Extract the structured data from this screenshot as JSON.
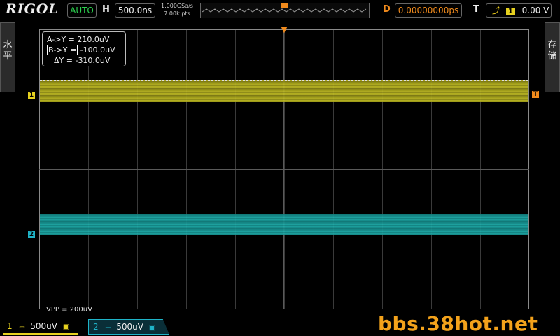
{
  "header": {
    "brand": "RIGOL",
    "run_status": "AUTO",
    "horizontal_label": "H",
    "timebase": "500.0ns",
    "sample_rate": "1.000GSa/s",
    "memory_depth": "7.00k pts",
    "delay_label": "D",
    "delay": "0.00000000ps",
    "trigger_label": "T",
    "trigger_source": "1",
    "trigger_level": "0.00 V"
  },
  "side": {
    "left_tab": "水\n平",
    "right_tab": "存\n储"
  },
  "cursor": {
    "a_label": "A->Y =",
    "a_value": "210.0uV",
    "b_label": "B->Y =",
    "b_value": "-100.0uV",
    "delta_label": "ΔY =",
    "delta_value": "-310.0uV"
  },
  "measurement": {
    "vpp": "VPP = 200uV"
  },
  "channels": [
    {
      "number": "1",
      "scale": "500uV",
      "color": "#e6d11f"
    },
    {
      "number": "2",
      "scale": "500uV",
      "color": "#1fb4c8"
    }
  ],
  "trigger_marker": "T",
  "watermark": "bbs.38hot.net",
  "colors": {
    "ch1": "#e6d11f",
    "ch2": "#1fb4c8",
    "trigger": "#f08a1c",
    "run": "#2bd14e"
  }
}
